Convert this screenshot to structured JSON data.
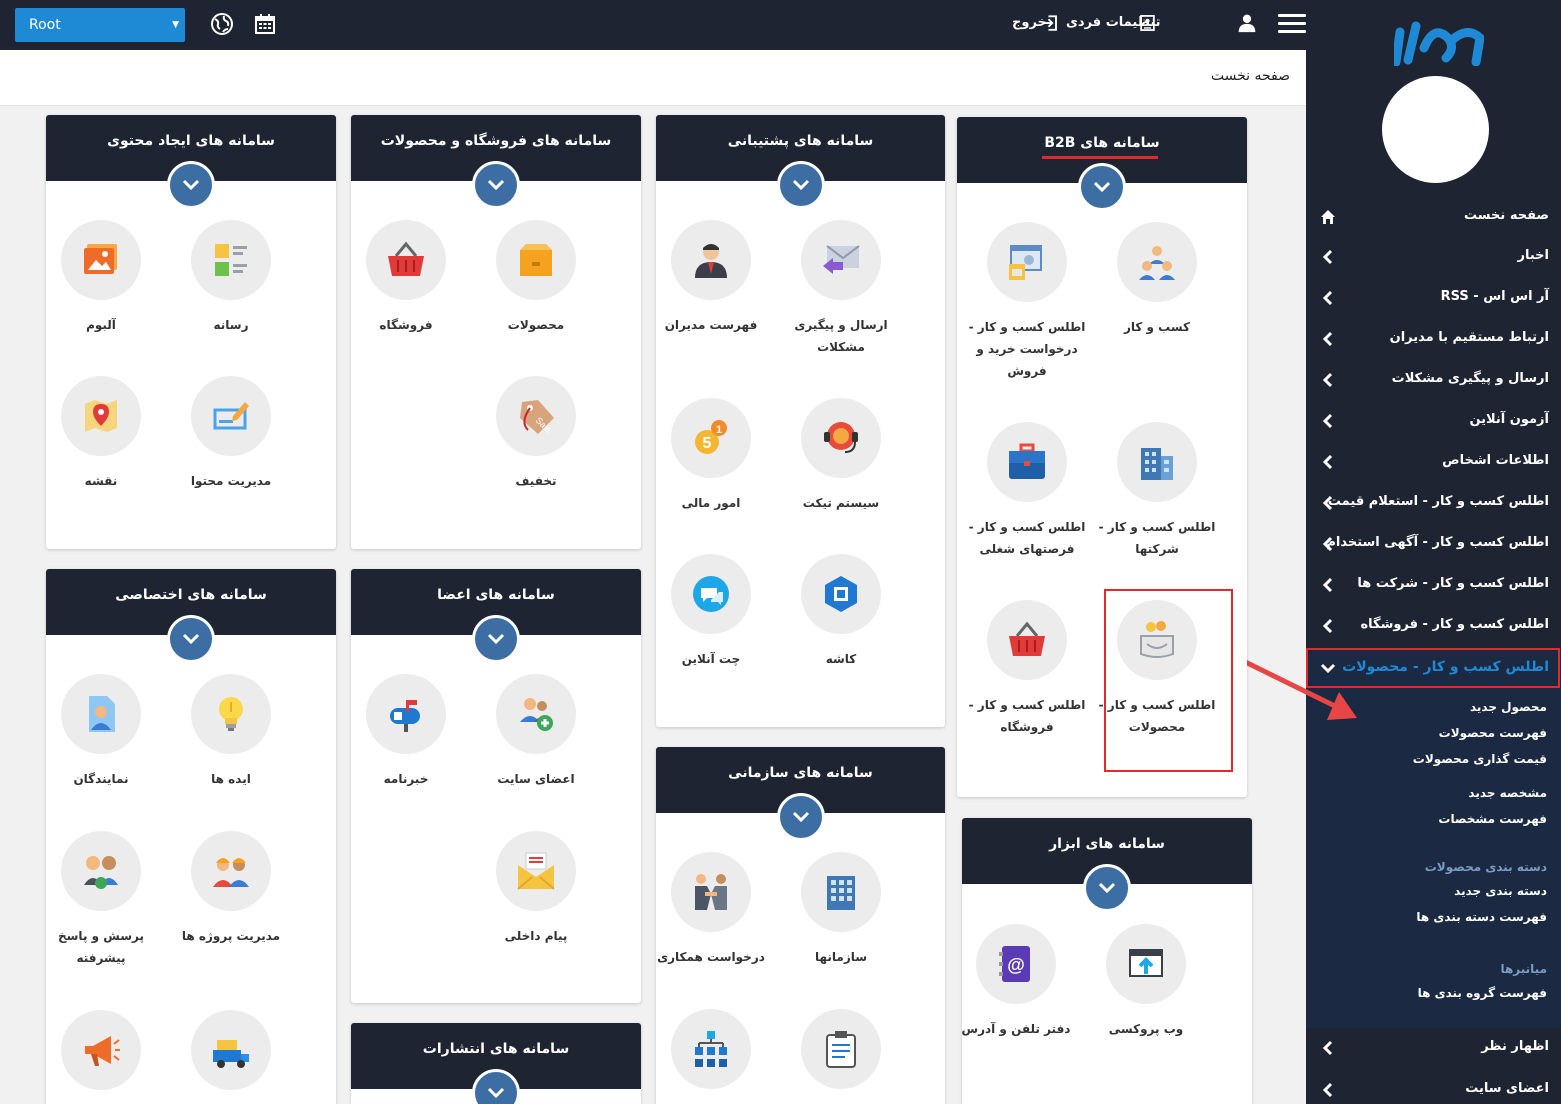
{
  "topbar": {
    "root_select": "Root",
    "personal_settings": "تنظیمات فردی",
    "logout": "خروج"
  },
  "breadcrumb": {
    "title": "صفحه نخست"
  },
  "sidebar": {
    "nav": [
      {
        "label": "صفحه نخست",
        "icon": "home-icon"
      },
      {
        "label": "اخبار",
        "icon": "chevron-left-icon"
      },
      {
        "label": "آر اس اس - RSS",
        "icon": "chevron-left-icon"
      },
      {
        "label": "ارتباط مستقیم با مدیران",
        "icon": "chevron-left-icon"
      },
      {
        "label": "ارسال و پیگیری مشکلات",
        "icon": "chevron-left-icon"
      },
      {
        "label": "آزمون آنلاین",
        "icon": "chevron-left-icon"
      },
      {
        "label": "اطلاعات اشخاص",
        "icon": "chevron-left-icon"
      },
      {
        "label": "اطلس کسب و کار - استعلام قیمت",
        "icon": "chevron-left-icon"
      },
      {
        "label": "اطلس کسب و کار - آگهی استخدام",
        "icon": "chevron-left-icon"
      },
      {
        "label": "اطلس کسب و کار - شرکت ها",
        "icon": "chevron-left-icon"
      },
      {
        "label": "اطلس کسب و کار - فروشگاه",
        "icon": "chevron-left-icon"
      },
      {
        "label": "اطلس کسب و کار - محصولات",
        "icon": "chevron-down-icon"
      }
    ],
    "sub": [
      {
        "label": "محصول جدید",
        "kind": "item"
      },
      {
        "label": "فهرست محصولات",
        "kind": "item"
      },
      {
        "label": "قیمت گذاری محصولات",
        "kind": "item"
      },
      {
        "label": "مشخصه جدید",
        "kind": "item"
      },
      {
        "label": "فهرست مشخصات",
        "kind": "item"
      },
      {
        "label": "دسته بندی محصولات",
        "kind": "head"
      },
      {
        "label": "دسته بندی جدید",
        "kind": "item"
      },
      {
        "label": "فهرست دسته بندی ها",
        "kind": "item"
      },
      {
        "label": "میانبرها",
        "kind": "head"
      },
      {
        "label": "فهرست گروه بندی ها",
        "kind": "item"
      }
    ],
    "nav_after": [
      {
        "label": "اظهار نظر",
        "icon": "chevron-left-icon"
      },
      {
        "label": "اعضای سایت",
        "icon": "chevron-left-icon"
      }
    ]
  },
  "cards": {
    "b2b": {
      "title_prefix": "سامانه های",
      "title_highlight": "B2B",
      "tiles": [
        {
          "label": "کسب و کار",
          "icon": "business-people-icon"
        },
        {
          "label": "اطلس کسب و کار - درخواست خرید و فروش",
          "icon": "purchase-request-icon"
        },
        {
          "label": "اطلس کسب و کار - شرکتها",
          "icon": "building-icon"
        },
        {
          "label": "اطلس کسب و کار - فرصتهای شغلی",
          "icon": "briefcase-icon"
        },
        {
          "label": "اطلس کسب و کار - محصولات",
          "icon": "products-box-icon"
        },
        {
          "label": "اطلس کسب و کار - فروشگاه",
          "icon": "basket-icon"
        }
      ]
    },
    "support": {
      "title": "سامانه های پشتیبانی",
      "tiles": [
        {
          "label": "ارسال و پیگیری مشکلات",
          "icon": "mail-reply-icon"
        },
        {
          "label": "فهرست مدیران",
          "icon": "manager-icon"
        },
        {
          "label": "سیستم تیکت",
          "icon": "support-headset-icon"
        },
        {
          "label": "امور مالی",
          "icon": "coins-icon"
        },
        {
          "label": "کاشه",
          "icon": "chip-icon"
        },
        {
          "label": "چت آنلاین",
          "icon": "chat-icon"
        }
      ]
    },
    "shop": {
      "title": "سامانه های فروشگاه و محصولات",
      "tiles": [
        {
          "label": "محصولات",
          "icon": "product-box-icon"
        },
        {
          "label": "فروشگاه",
          "icon": "basket-icon"
        },
        {
          "label": "تخفیف",
          "icon": "sale-tag-icon"
        }
      ]
    },
    "content": {
      "title": "سامانه های ایجاد محتوی",
      "tiles": [
        {
          "label": "رسانه",
          "icon": "media-icon"
        },
        {
          "label": "آلبوم",
          "icon": "album-icon"
        },
        {
          "label": "مدیریت محتوا",
          "icon": "edit-content-icon"
        },
        {
          "label": "نقشه",
          "icon": "map-icon"
        }
      ]
    },
    "members": {
      "title": "سامانه های اعضا",
      "tiles": [
        {
          "label": "اعضای سایت",
          "icon": "add-users-icon"
        },
        {
          "label": "خبرنامه",
          "icon": "mailbox-icon"
        },
        {
          "label": "پیام داخلی",
          "icon": "envelope-icon"
        }
      ]
    },
    "special": {
      "title": "سامانه های اختصاصی",
      "tiles": [
        {
          "label": "ایده ها",
          "icon": "lightbulb-icon"
        },
        {
          "label": "نمایندگان",
          "icon": "representative-icon"
        },
        {
          "label": "مدیریت پروژه ها",
          "icon": "workers-icon"
        },
        {
          "label": "پرسش و پاسخ پیشرفته",
          "icon": "qa-icon"
        },
        {
          "label": "",
          "icon": "truck-icon"
        },
        {
          "label": "",
          "icon": "megaphone-icon"
        }
      ]
    },
    "org": {
      "title": "سامانه های سازمانی",
      "tiles": [
        {
          "label": "سازمانها",
          "icon": "organization-icon"
        },
        {
          "label": "درخواست همکاری",
          "icon": "handshake-icon"
        },
        {
          "label": "",
          "icon": "clipboard-icon"
        },
        {
          "label": "",
          "icon": "hierarchy-icon"
        }
      ]
    },
    "tools": {
      "title": "سامانه های ابزار",
      "tiles": [
        {
          "label": "وب پروکسی",
          "icon": "web-proxy-icon"
        },
        {
          "label": "دفتر تلفن و آدرس",
          "icon": "address-book-icon"
        }
      ]
    },
    "publish": {
      "title": "سامانه های انتشارات"
    }
  },
  "colors": {
    "dark": "#1e2431",
    "accent": "#1e8ad6",
    "toggle": "#3c6ea3",
    "highlight": "#e12b2b"
  }
}
